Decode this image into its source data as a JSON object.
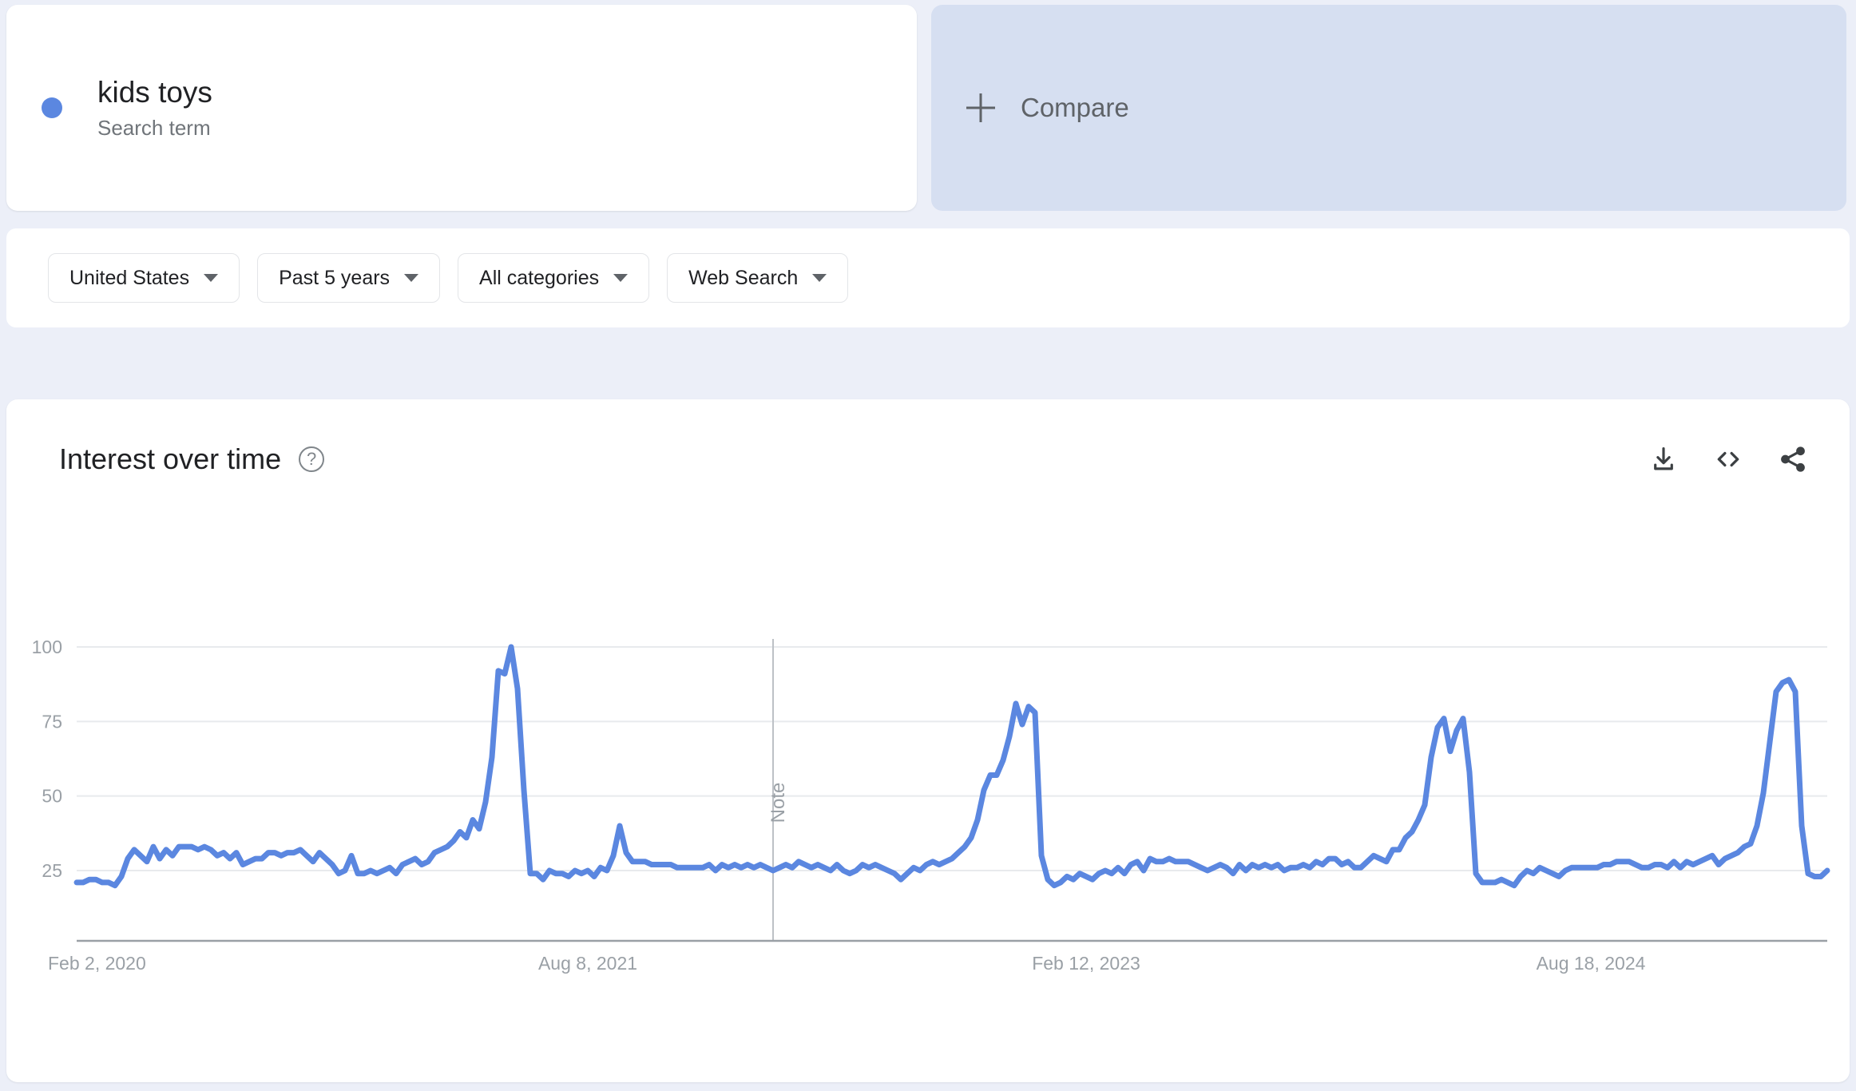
{
  "search_term": {
    "label": "kids toys",
    "subtitle": "Search term",
    "dot_color": "#5b87e0"
  },
  "compare": {
    "label": "Compare",
    "icon": "plus-icon"
  },
  "filters": [
    {
      "label": "United States",
      "icon": "chevron-down-icon"
    },
    {
      "label": "Past 5 years",
      "icon": "chevron-down-icon"
    },
    {
      "label": "All categories",
      "icon": "chevron-down-icon"
    },
    {
      "label": "Web Search",
      "icon": "chevron-down-icon"
    }
  ],
  "chart_card": {
    "title": "Interest over time",
    "help_icon": "help-circle-icon",
    "help_glyph": "?",
    "actions": [
      {
        "name": "download-icon",
        "tooltip": "Download"
      },
      {
        "name": "embed-code-icon",
        "tooltip": "Embed"
      },
      {
        "name": "share-icon",
        "tooltip": "Share"
      }
    ]
  },
  "chart_data": {
    "type": "line",
    "title": "Interest over time",
    "xlabel": "",
    "ylabel": "",
    "ylim": [
      0,
      100
    ],
    "yticks": [
      25,
      50,
      75,
      100
    ],
    "grid": true,
    "legend_position": "none",
    "line_color": "#5b87e0",
    "xticks": [
      "Feb 2, 2020",
      "Aug 8, 2021",
      "Feb 12, 2023",
      "Aug 18, 2024"
    ],
    "xtick_positions": [
      0,
      80,
      158,
      237
    ],
    "annotations": [
      {
        "text": "Note",
        "x_index": 109,
        "orientation": "vertical"
      }
    ],
    "series": [
      {
        "name": "kids toys",
        "values": [
          21,
          21,
          22,
          22,
          21,
          21,
          20,
          23,
          29,
          32,
          30,
          28,
          33,
          29,
          32,
          30,
          33,
          33,
          33,
          32,
          33,
          32,
          30,
          31,
          29,
          31,
          27,
          28,
          29,
          29,
          31,
          31,
          30,
          31,
          31,
          32,
          30,
          28,
          31,
          29,
          27,
          24,
          25,
          30,
          24,
          24,
          25,
          24,
          25,
          26,
          24,
          27,
          28,
          29,
          27,
          28,
          31,
          32,
          33,
          35,
          38,
          36,
          42,
          39,
          48,
          63,
          92,
          91,
          100,
          86,
          52,
          24,
          24,
          22,
          25,
          24,
          24,
          23,
          25,
          24,
          25,
          23,
          26,
          25,
          30,
          40,
          31,
          28,
          28,
          28,
          27,
          27,
          27,
          27,
          26,
          26,
          26,
          26,
          26,
          27,
          25,
          27,
          26,
          27,
          26,
          27,
          26,
          27,
          26,
          25,
          26,
          27,
          26,
          28,
          27,
          26,
          27,
          26,
          25,
          27,
          25,
          24,
          25,
          27,
          26,
          27,
          26,
          25,
          24,
          22,
          24,
          26,
          25,
          27,
          28,
          27,
          28,
          29,
          31,
          33,
          36,
          42,
          52,
          57,
          57,
          62,
          70,
          81,
          74,
          80,
          78,
          30,
          22,
          20,
          21,
          23,
          22,
          24,
          23,
          22,
          24,
          25,
          24,
          26,
          24,
          27,
          28,
          25,
          29,
          28,
          28,
          29,
          28,
          28,
          28,
          27,
          26,
          25,
          26,
          27,
          26,
          24,
          27,
          25,
          27,
          26,
          27,
          26,
          27,
          25,
          26,
          26,
          27,
          26,
          28,
          27,
          29,
          29,
          27,
          28,
          26,
          26,
          28,
          30,
          29,
          28,
          32,
          32,
          36,
          38,
          42,
          47,
          63,
          73,
          76,
          65,
          72,
          76,
          58,
          24,
          21,
          21,
          21,
          22,
          21,
          20,
          23,
          25,
          24,
          26,
          25,
          24,
          23,
          25,
          26,
          26,
          26,
          26,
          26,
          27,
          27,
          28,
          28,
          28,
          27,
          26,
          26,
          27,
          27,
          26,
          28,
          26,
          28,
          27,
          28,
          29,
          30,
          27,
          29,
          30,
          31,
          33,
          34,
          40,
          51,
          68,
          85,
          88,
          89,
          85,
          40,
          24,
          23,
          23,
          25
        ]
      }
    ]
  }
}
